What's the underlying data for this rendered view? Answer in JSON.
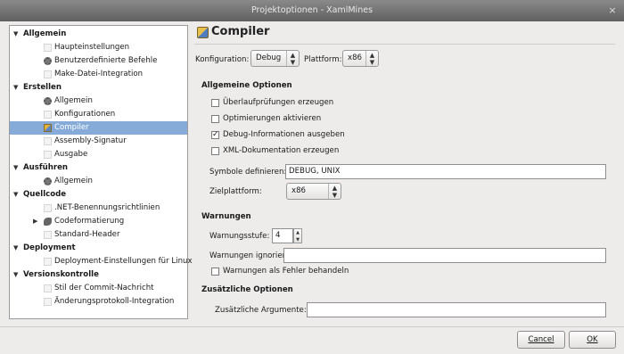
{
  "window": {
    "title": "Projektoptionen - XamlMines",
    "close_glyph": "×"
  },
  "tree": {
    "groups": [
      {
        "label": "Allgemein",
        "items": [
          "Haupteinstellungen",
          "Benutzerdefinierte Befehle",
          "Make-Datei-Integration"
        ]
      },
      {
        "label": "Erstellen",
        "items": [
          "Allgemein",
          "Konfigurationen",
          "Compiler",
          "Assembly-Signatur",
          "Ausgabe"
        ]
      },
      {
        "label": "Ausführen",
        "items": [
          "Allgemein"
        ]
      },
      {
        "label": "Quellcode",
        "items": [
          ".NET-Benennungsrichtlinien",
          "Codeformatierung",
          "Standard-Header"
        ]
      },
      {
        "label": "Deployment",
        "items": [
          "Deployment-Einstellungen für Linux"
        ]
      },
      {
        "label": "Versionskontrolle",
        "items": [
          "Stil der Commit-Nachricht",
          "Änderungsprotokoll-Integration"
        ]
      }
    ],
    "selected_item": "Compiler"
  },
  "panel": {
    "title": "Compiler",
    "konfiguration_label": "Konfiguration:",
    "konfiguration_value": "Debug",
    "plattform_label": "Plattform:",
    "plattform_value": "x86",
    "general_heading": "Allgemeine Optionen",
    "checks": [
      {
        "label": "Überlaufprüfungen erzeugen",
        "checked": false
      },
      {
        "label": "Optimierungen aktivieren",
        "checked": false
      },
      {
        "label": "Debug-Informationen ausgeben",
        "checked": true
      },
      {
        "label": "XML-Dokumentation erzeugen",
        "checked": false
      }
    ],
    "symbols_label": "Symbole definieren:",
    "symbols_value": "DEBUG, UNIX",
    "zielplattform_label": "Zielplattform:",
    "zielplattform_value": "x86",
    "warnings_heading": "Warnungen",
    "warnstufe_label": "Warnungsstufe:",
    "warnstufe_value": "4",
    "ignore_label": "Warnungen ignorieren:",
    "ignore_value": "",
    "treat_as_errors_label": "Warnungen als Fehler behandeln",
    "treat_as_errors_checked": false,
    "extra_heading": "Zusätzliche Optionen",
    "extra_args_label": "Zusätzliche Argumente:",
    "extra_args_value": ""
  },
  "footer": {
    "cancel_label": "Cancel",
    "ok_label": "OK"
  },
  "glyphs": {
    "expanded": "▼",
    "collapsed": "▶",
    "check": "✓",
    "up": "▲",
    "down": "▼",
    "updown": "⇕"
  },
  "colors": {
    "selection": "#86abd9",
    "titlebar": "#6e6e6e"
  }
}
